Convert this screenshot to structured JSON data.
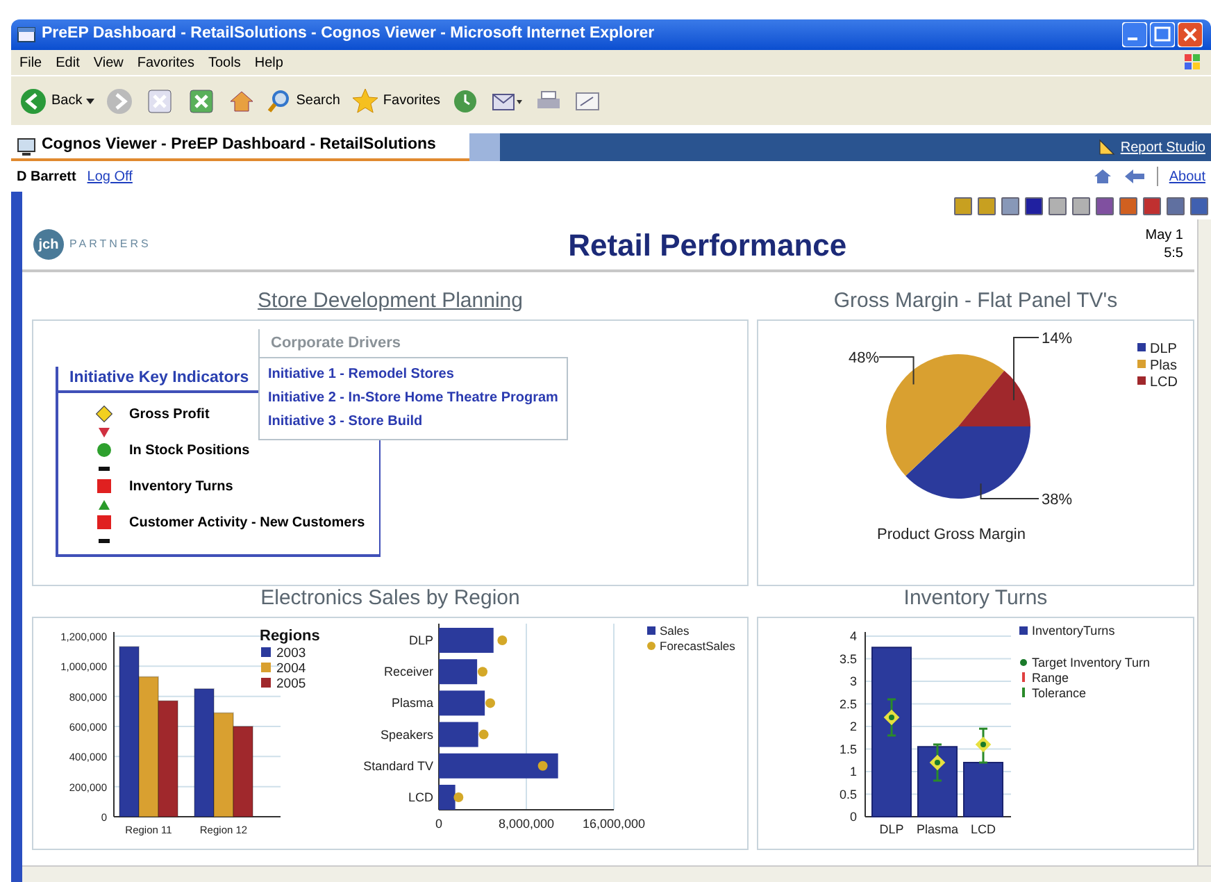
{
  "window": {
    "title": "PreEP Dashboard - RetailSolutions - Cognos Viewer - Microsoft Internet Explorer"
  },
  "menu": [
    "File",
    "Edit",
    "View",
    "Favorites",
    "Tools",
    "Help"
  ],
  "toolbar": {
    "back": "Back",
    "search": "Search",
    "favorites": "Favorites"
  },
  "viewer": {
    "tab": "Cognos Viewer - PreEP Dashboard - RetailSolutions",
    "report_studio": "Report Studio",
    "user": "D Barrett",
    "log_off": "Log Off",
    "about": "About"
  },
  "header": {
    "logo_mark": "jch",
    "logo": "PARTNERS",
    "title": "Retail Performance",
    "date": "May 1",
    "time": "5:5"
  },
  "store_development": {
    "title": "Store Development Planning",
    "indicators": {
      "title": "Initiative Key Indicators",
      "items": [
        {
          "label": "Gross Profit",
          "kind": "diamond",
          "color": "#f2d020",
          "trend": {
            "kind": "down"
          }
        },
        {
          "label": "In Stock Positions",
          "kind": "circle",
          "color": "#2ea02e",
          "trend": {
            "kind": "flat"
          }
        },
        {
          "label": "Inventory Turns",
          "kind": "square",
          "color": "#e02020",
          "trend": {
            "kind": "up"
          }
        },
        {
          "label": "Customer Activity - New Customers",
          "kind": "square",
          "color": "#e02020",
          "trend": {
            "kind": "flat"
          }
        }
      ]
    },
    "drivers": {
      "title": "Corporate Drivers",
      "links": [
        "Initiative 1 - Remodel Stores",
        "Initiative 2 - In-Store Home Theatre Program",
        "Initiative 3 - Store Build"
      ]
    }
  },
  "gross_margin": {
    "title": "Gross Margin - Flat Panel TV's",
    "swatches": [
      {
        "color": "#2b3a9c"
      },
      {
        "color": "#d9a030"
      },
      {
        "color": "#a0282c"
      }
    ],
    "chart_data": {
      "type": "pie",
      "title": "Product Gross Margin",
      "legend": "right",
      "categories": [
        "DLP",
        "Plas",
        "LCD"
      ],
      "values": [
        38,
        48,
        14
      ],
      "value_labels": [
        "38%",
        "48%",
        "14%"
      ]
    }
  },
  "sales": {
    "title": "Electronics Sales by Region",
    "region_chart": {
      "chart_data": {
        "type": "bar",
        "grid": true,
        "legend": "right",
        "legend_title": "Regions",
        "categories": [
          "Region 11",
          "Region 12"
        ],
        "ylim": [
          0,
          1200000
        ],
        "yticks": [
          {
            "value": 0,
            "label": "0"
          },
          {
            "value": 200000,
            "label": "200,000"
          },
          {
            "value": 400000,
            "label": "400,000"
          },
          {
            "value": 600000,
            "label": "600,000"
          },
          {
            "value": 800000,
            "label": "800,000"
          },
          {
            "value": 1000000,
            "label": "1,000,000"
          },
          {
            "value": 1200000,
            "label": "1,200,000"
          }
        ],
        "series": [
          {
            "name": "2003",
            "color": "#2b3a9c",
            "values": [
              1130000,
              850000
            ]
          },
          {
            "name": "2004",
            "color": "#d9a030",
            "values": [
              930000,
              690000
            ]
          },
          {
            "name": "2005",
            "color": "#a0282c",
            "values": [
              770000,
              600000
            ]
          }
        ]
      }
    },
    "product_chart": {
      "chart_data": {
        "type": "bar",
        "orientation": "horizontal",
        "stacked": false,
        "grid": true,
        "legend": "right",
        "categories": [
          "DLP",
          "Receiver",
          "Plasma",
          "Speakers",
          "Standard TV",
          "LCD"
        ],
        "xlim": [
          0,
          16000000
        ],
        "xticks": [
          {
            "value": 0,
            "label": "0"
          },
          {
            "value": 8000000,
            "label": "8,000,000"
          },
          {
            "value": 16000000,
            "label": "16,000,000"
          }
        ],
        "series": [
          {
            "name": "Sales",
            "type": "bar",
            "color": "#2b3a9c",
            "values": [
              5000000,
              3500000,
              4200000,
              3600000,
              10900000,
              1500000
            ]
          },
          {
            "name": "ForecastSales",
            "type": "scatter",
            "color": "#d4a828",
            "values": [
              5800000,
              4000000,
              4700000,
              4100000,
              9500000,
              1800000
            ]
          }
        ]
      }
    }
  },
  "inventory": {
    "title": "Inventory Turns",
    "chart_data": {
      "type": "bar",
      "grid": true,
      "legend": "right",
      "categories": [
        "DLP",
        "Plasma",
        "LCD"
      ],
      "ylim": [
        0,
        4
      ],
      "yticks": [
        {
          "value": 0,
          "label": "0"
        },
        {
          "value": 0.5,
          "label": "0.5"
        },
        {
          "value": 1,
          "label": "1"
        },
        {
          "value": 1.5,
          "label": "1.5"
        },
        {
          "value": 2,
          "label": "2"
        },
        {
          "value": 2.5,
          "label": "2.5"
        },
        {
          "value": 3,
          "label": "3"
        },
        {
          "value": 3.5,
          "label": "3.5"
        },
        {
          "value": 4,
          "label": "4"
        }
      ],
      "series": [
        {
          "name": "InventoryTurns",
          "type": "bar",
          "color": "#2b3a9c",
          "values": [
            3.75,
            1.55,
            1.2
          ]
        },
        {
          "name": "Target Inventory Turn",
          "type": "scatter",
          "color": "#1a7a2a",
          "values": [
            2.2,
            1.2,
            1.6
          ]
        },
        {
          "name": "Range",
          "type": "other",
          "color": "#e04040",
          "values": [
            null,
            null,
            null
          ]
        },
        {
          "name": "Tolerance",
          "type": "candlestick",
          "color": "#2a8a2a",
          "ohlc": [
            [
              2.2,
              2.6,
              1.8,
              2.2
            ],
            [
              1.2,
              1.6,
              0.8,
              1.2
            ],
            [
              1.6,
              1.95,
              1.2,
              1.6
            ]
          ]
        }
      ]
    }
  }
}
